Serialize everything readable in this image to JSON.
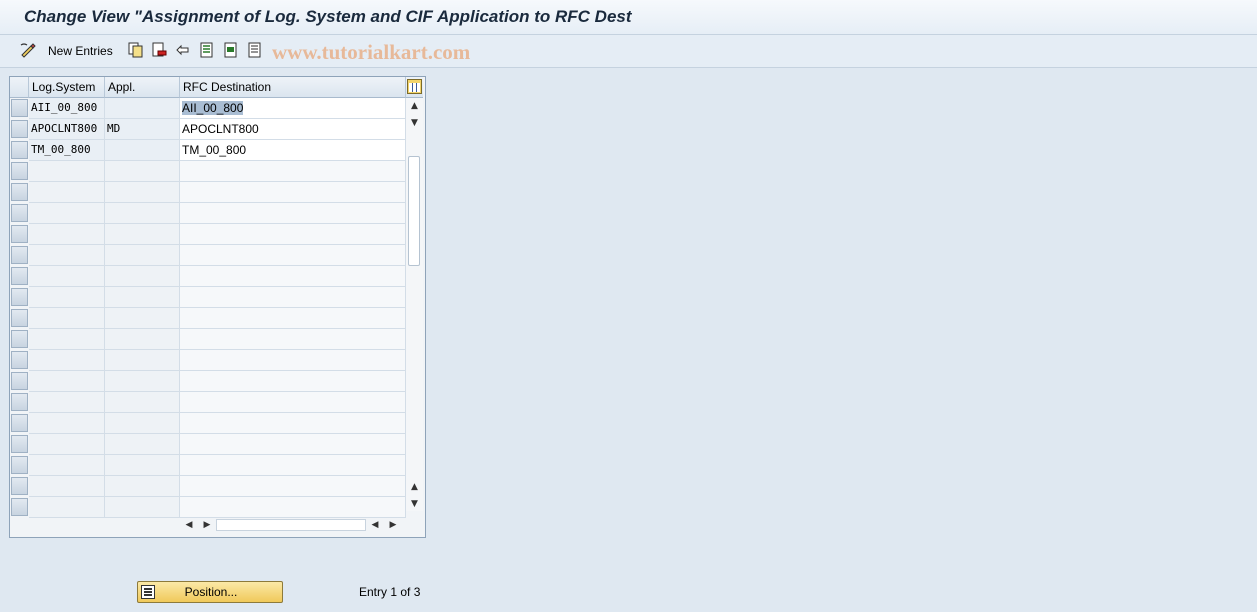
{
  "window": {
    "title": "Change View \"Assignment of Log. System and CIF Application to RFC Dest"
  },
  "toolbar": {
    "new_entries_label": "New Entries",
    "watermark": "www.tutorialkart.com",
    "icons": [
      "display-change-icon",
      "copy-as-icon",
      "delete-icon",
      "undo-change-icon",
      "select-all-icon",
      "select-block-icon",
      "deselect-all-icon"
    ]
  },
  "table": {
    "columns": [
      "Log.System",
      "Appl.",
      "RFC Destination"
    ],
    "rows": [
      {
        "log_system": "AII_00_800",
        "appl": "",
        "rfc_destination": "AII_00_800"
      },
      {
        "log_system": "APOCLNT800",
        "appl": "MD",
        "rfc_destination": "APOCLNT800"
      },
      {
        "log_system": "TM_00_800",
        "appl": "",
        "rfc_destination": "TM_00_800"
      }
    ],
    "visible_row_count": 20
  },
  "footer": {
    "position_button_label": "Position...",
    "entry_info": "Entry 1 of 3"
  },
  "colors": {
    "background": "#dfe8f1",
    "key_cell": "#e9eff5",
    "selection": "#a9bdd3",
    "button": "#f0c95a"
  }
}
